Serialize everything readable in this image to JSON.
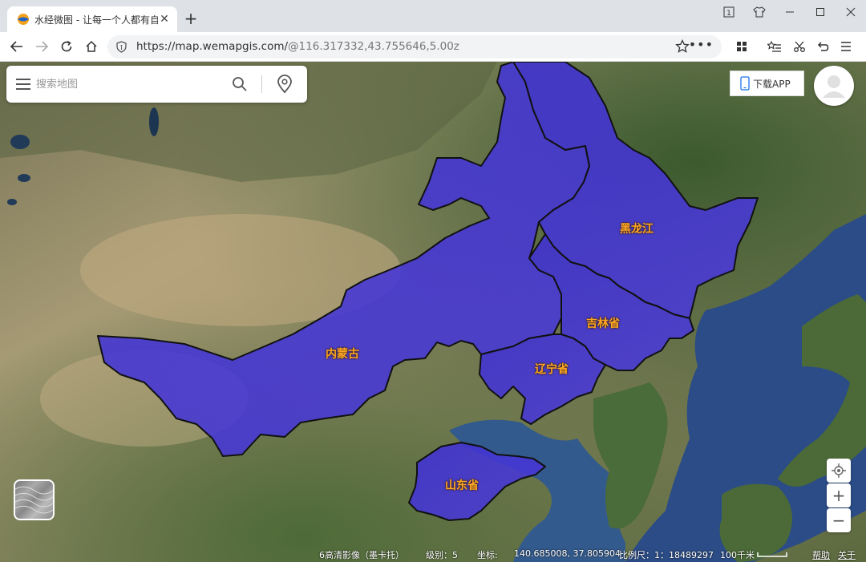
{
  "browser": {
    "tab_title": "水经微图 - 让每一个人都有自",
    "tab_close": "✕",
    "new_tab": "+",
    "url_host": "https://map.wemapgis.com/",
    "url_rest": "@116.317332,43.755646,5.00z"
  },
  "search": {
    "placeholder": "搜索地图"
  },
  "header": {
    "download_label": "下载APP"
  },
  "provinces": [
    {
      "name": "黑龙江"
    },
    {
      "name": "吉林省"
    },
    {
      "name": "辽宁省"
    },
    {
      "name": "内蒙古"
    },
    {
      "name": "山东省"
    }
  ],
  "controls": {
    "zoom_in": "+",
    "zoom_out": "−"
  },
  "status": {
    "imagery": "6高清影像（墨卡托）",
    "level": "级别：5",
    "coord_label": "坐标:",
    "coord_value": "140.685008, 37.805904",
    "scale": "比例尺：1：18489297",
    "scale_bar": "100千米",
    "help": "帮助",
    "about": "关于"
  },
  "colors": {
    "province_fill": "#3d2fd0",
    "province_label": "#ffa726",
    "accent": "#1a73e8"
  }
}
